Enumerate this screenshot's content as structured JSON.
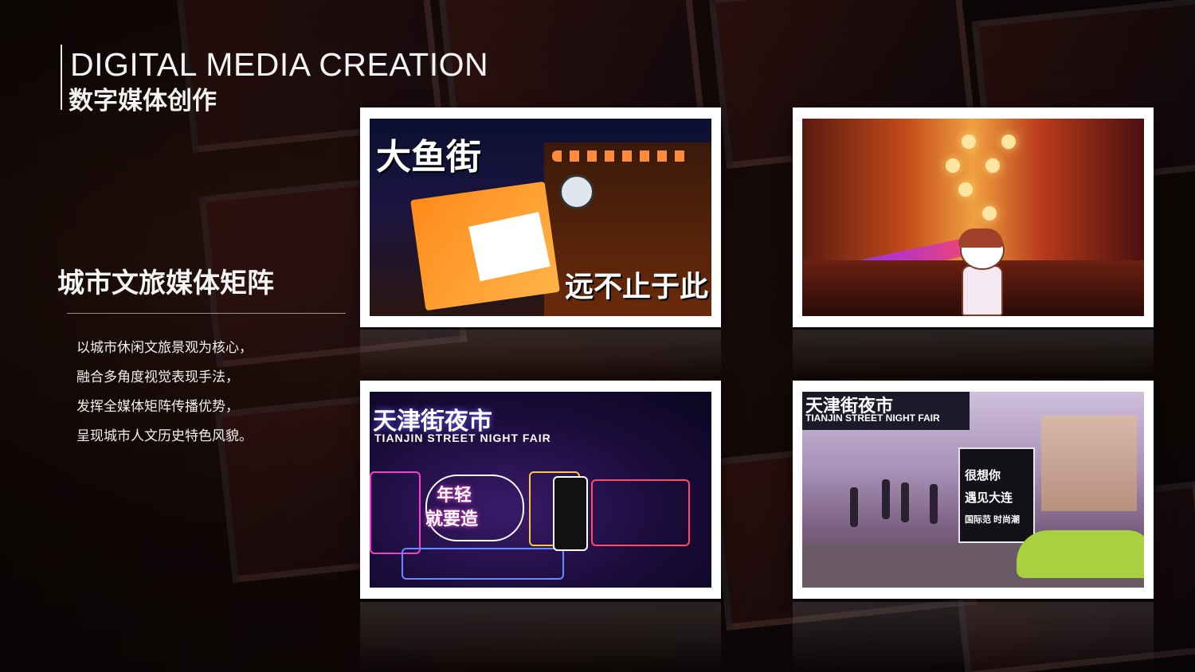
{
  "header": {
    "title_en": "DIGITAL MEDIA CREATION",
    "title_cn": "数字媒体创作"
  },
  "section": {
    "title": "城市文旅媒体矩阵",
    "description_lines": [
      "以城市休闲文旅景观为核心，",
      "融合多角度视觉表现手法，",
      "发挥全媒体矩阵传播优势，",
      "呈现城市人文历史特色风貌。"
    ]
  },
  "photos": {
    "p1": {
      "overlay_title": "大鱼街",
      "overlay_sub": "远不止于此"
    },
    "p3": {
      "sign_title": "天津街夜市",
      "sign_sub": "TIANJIN STREET NIGHT FAIR",
      "neon_1": "年轻",
      "neon_2": "就要造"
    },
    "p4": {
      "arch_title": "天津街夜市",
      "arch_sub": "TIANJIN STREET NIGHT FAIR",
      "board_1": "很想你",
      "board_2": "遇见大连",
      "board_3": "国际范 时尚潮"
    }
  },
  "colors": {
    "background": "#0d0808",
    "frame": "#ffffff",
    "text": "#f3f3f3"
  }
}
